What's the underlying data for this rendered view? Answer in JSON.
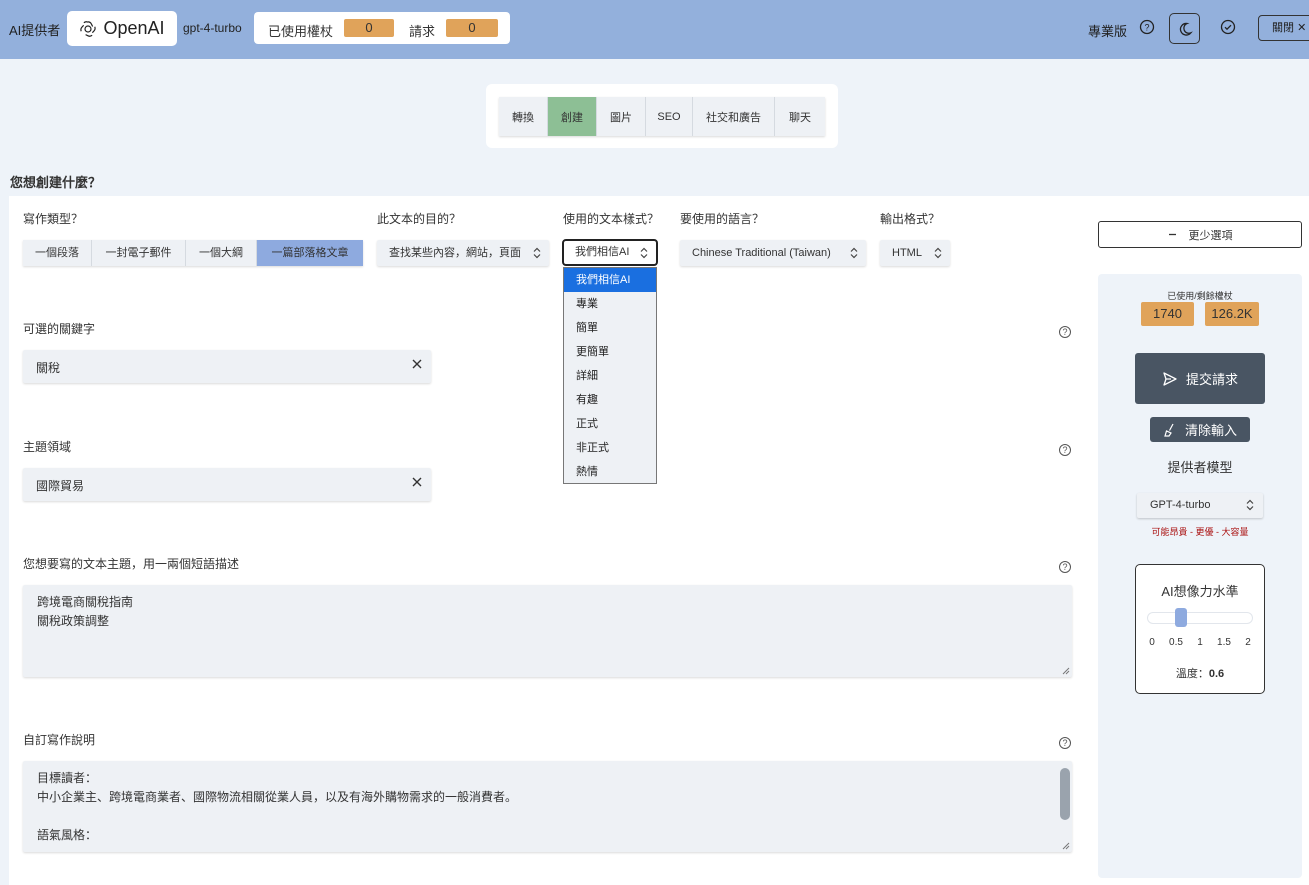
{
  "header": {
    "provider_label": "AI提供者",
    "provider_name": "OpenAI",
    "model": "gpt-4-turbo",
    "used_tokens_label": "已使用權杖",
    "used_tokens_value": "0",
    "requests_label": "請求",
    "requests_value": "0",
    "pro_label": "專業版",
    "close_label": "關閉"
  },
  "tabs": [
    "轉換",
    "創建",
    "圖片",
    "SEO",
    "社交和廣告",
    "聊天"
  ],
  "active_tab": "創建",
  "page_question": "您想創建什麼？",
  "form": {
    "writing_type_label": "寫作類型？",
    "writing_types": [
      "一個段落",
      "一封電子郵件",
      "一個大綱",
      "一篇部落格文章"
    ],
    "writing_type_selected": "一篇部落格文章",
    "purpose_label": "此文本的目的？",
    "purpose_value": "查找某些內容，網站，頁面",
    "style_label": "使用的文本樣式？",
    "style_value": "我們相信AI",
    "style_options": [
      "我們相信AI",
      "專業",
      "簡單",
      "更簡單",
      "詳細",
      "有趣",
      "正式",
      "非正式",
      "熱情"
    ],
    "language_label": "要使用的語言？",
    "language_value": "Chinese Traditional (Taiwan)",
    "format_label": "輸出格式？",
    "format_value": "HTML",
    "keywords_label": "可選的關鍵字",
    "keywords_value": "關稅",
    "domain_label": "主題領域",
    "domain_value": "國際貿易",
    "topic_label": "您想要寫的文本主題，用一兩個短語描述",
    "topic_lines": [
      "跨境電商關稅指南",
      "關稅政策調整"
    ],
    "instructions_label": "自訂寫作說明",
    "instructions_lines": [
      "目標讀者：",
      "中小企業主、跨境電商業者、國際物流相關從業人員，以及有海外購物需求的一般消費者。",
      "",
      "語氣風格："
    ]
  },
  "sidebar": {
    "less_options_label": "更少選項",
    "tokens_label": "已使用/剩餘權杖",
    "tokens_used": "1740",
    "tokens_remaining": "126.2K",
    "submit_label": "提交請求",
    "clear_label": "清除輸入",
    "model_title": "提供者模型",
    "model_value": "GPT-4-turbo",
    "model_note": "可能昂貴 - 更優 - 大容量",
    "temperature_title": "AI想像力水準",
    "temperature_ticks": [
      "0",
      "0.5",
      "1",
      "1.5",
      "2"
    ],
    "temperature_label": "溫度：",
    "temperature_value": "0.6",
    "temperature_min": 0,
    "temperature_max": 2
  },
  "colors": {
    "topbar": "#93b0dc",
    "accent_chip": "#e0a35a",
    "active_tab": "#8dbf95",
    "active_option": "#8eaadf",
    "primary_button": "#495563",
    "dropdown_highlight": "#1a6fe0"
  }
}
